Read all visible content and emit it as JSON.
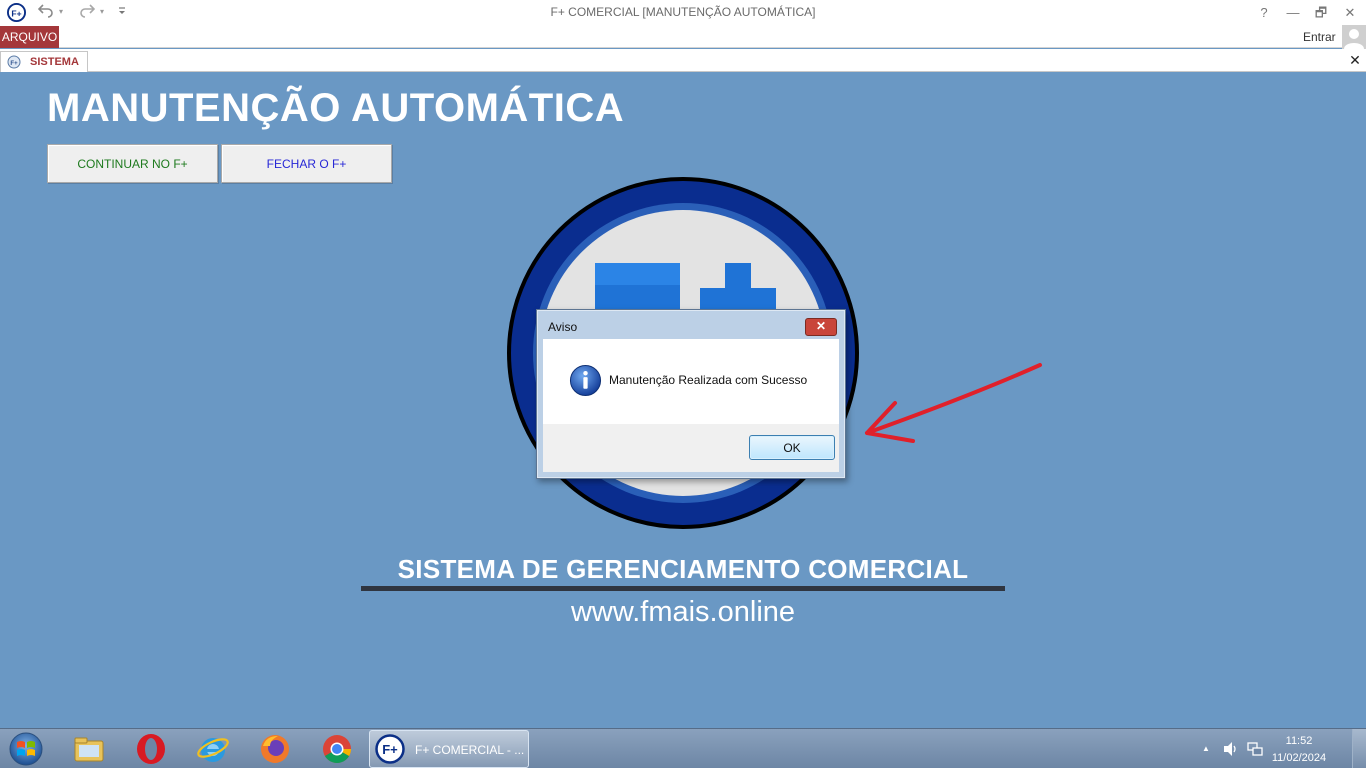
{
  "window": {
    "title": "F+ COMERCIAL [MANUTENÇÃO AUTOMÁTICA]",
    "help": "?",
    "minimize": "—",
    "restore": "🗗",
    "close": "✕"
  },
  "quick_access": {
    "undo_icon": "undo-icon",
    "redo_icon": "redo-icon",
    "customize_icon": "customize-icon",
    "caret": "▾"
  },
  "ribbon": {
    "file_tab": "ARQUIVO",
    "sign_in": "Entrar"
  },
  "document_tab": {
    "label": "SISTEMA",
    "close": "✕"
  },
  "main": {
    "title": "MANUTENÇÃO AUTOMÁTICA",
    "continue_button": "CONTINUAR NO F+",
    "close_button": "FECHAR O F+",
    "continue_color": "#1e7a1e",
    "close_color": "#2727d6",
    "logo_text": "F+",
    "system_name": "SISTEMA DE GERENCIAMENTO COMERCIAL",
    "website": "www.fmais.online"
  },
  "dialog": {
    "title": "Aviso",
    "close": "✕",
    "message": "Manutenção Realizada com Sucesso",
    "ok": "OK",
    "icon": "info-icon"
  },
  "annotation": {
    "arrow_color": "#e0202a"
  },
  "taskbar": {
    "start_icon": "windows-start-icon",
    "pinned": [
      "file-explorer-icon",
      "opera-icon",
      "internet-explorer-icon",
      "firefox-icon",
      "chrome-icon"
    ],
    "active_app": "F+ COMERCIAL - ...",
    "tray_up": "▲",
    "tray_volume": "🔊",
    "time": "11:52",
    "date": "11/02/2024"
  },
  "colors": {
    "background": "#6a98c4",
    "accent": "#a4373a",
    "logo_blue": "#0a2d8f"
  }
}
